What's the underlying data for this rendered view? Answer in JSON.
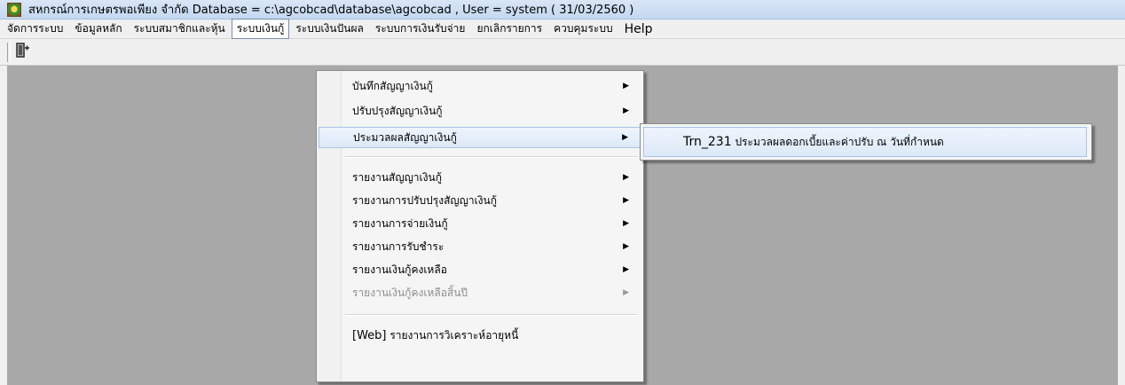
{
  "window": {
    "title": "สหกรณ์การเกษตรพอเพียง จำกัด Database = c:\\agcobcad\\database\\agcobcad , User = system ( 31/03/2560 )",
    "icon": "coop-logo-icon"
  },
  "menubar": {
    "items": [
      {
        "label": "จัดการระบบ"
      },
      {
        "label": "ข้อมูลหลัก"
      },
      {
        "label": "ระบบสมาชิกและหุ้น"
      },
      {
        "label": "ระบบเงินกู้"
      },
      {
        "label": "ระบบเงินปันผล"
      },
      {
        "label": "ระบบการเงินรับจ่าย"
      },
      {
        "label": "ยกเลิกรายการ"
      },
      {
        "label": "ควบคุมระบบ"
      },
      {
        "label": "Help"
      }
    ],
    "active_index": 3
  },
  "toolbar": {
    "exit_icon": "exit-door-icon"
  },
  "dropdown": {
    "items": [
      {
        "label": "บันทึกสัญญาเงินกู้",
        "submenu": true
      },
      {
        "label": "ปรับปรุงสัญญาเงินกู้",
        "submenu": true
      },
      {
        "label": "ประมวลผลสัญญาเงินกู้",
        "submenu": true,
        "highlighted": true
      },
      {
        "label": "รายงานสัญญาเงินกู้",
        "submenu": true
      },
      {
        "label": "รายงานการปรับปรุงสัญญาเงินกู้",
        "submenu": true
      },
      {
        "label": "รายงานการจ่ายเงินกู้",
        "submenu": true
      },
      {
        "label": "รายงานการรับชำระ",
        "submenu": true
      },
      {
        "label": "รายงานเงินกู้คงเหลือ",
        "submenu": true
      },
      {
        "label": "รายงานเงินกู้คงเหลือสิ้นปี",
        "submenu": true,
        "disabled": true
      },
      {
        "label_prefix": "[Web]",
        "label": "รายงานการวิเคราะห์อายุหนี้"
      }
    ],
    "arrow_glyph": "▶"
  },
  "submenu": {
    "code": "Trn_231",
    "label": "ประมวลผลดอกเบี้ยและค่าปรับ ณ วันที่กำหนด"
  },
  "colors": {
    "workspace": "#a8a8a8",
    "highlight_border": "#a8c4e6",
    "titlebar": "#c4d8f1"
  }
}
